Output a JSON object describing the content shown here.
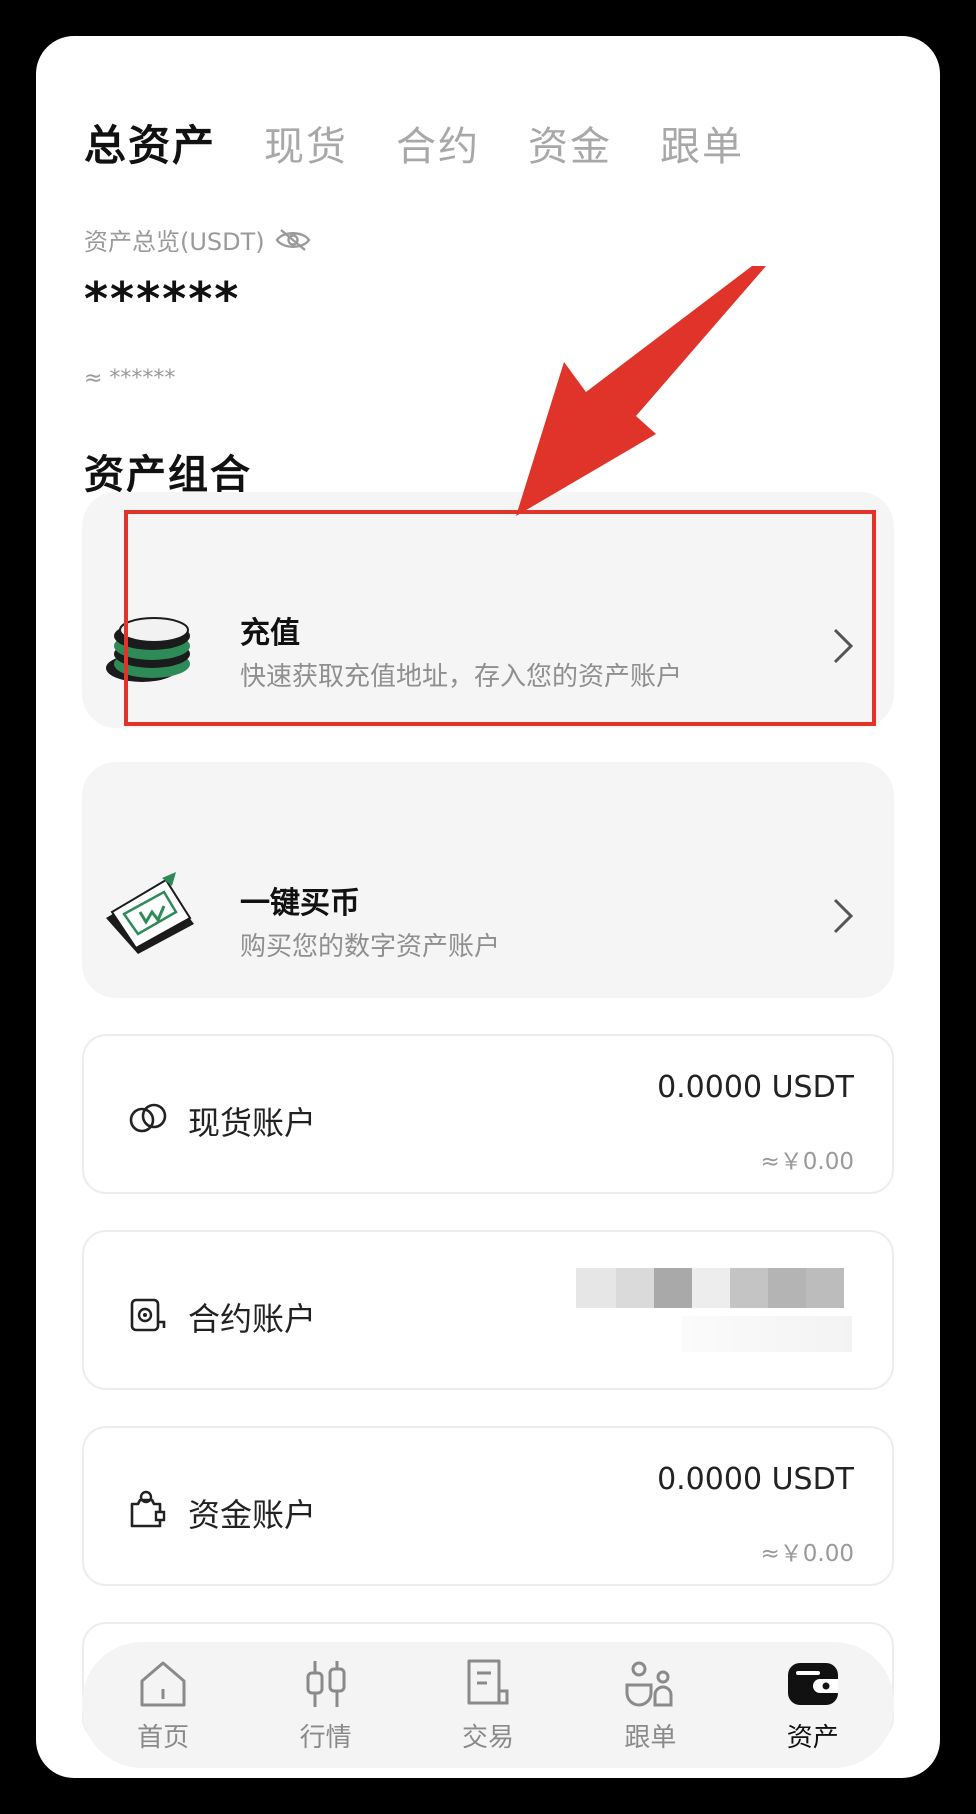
{
  "tabs": [
    {
      "label": "总资产",
      "active": true
    },
    {
      "label": "现货",
      "active": false
    },
    {
      "label": "合约",
      "active": false
    },
    {
      "label": "资金",
      "active": false
    },
    {
      "label": "跟单",
      "active": false
    }
  ],
  "overview": {
    "label": "资产总览(USDT)",
    "total": "******",
    "approx": "≈ ******"
  },
  "section_title": "资产组合",
  "actions": {
    "deposit": {
      "title": "充值",
      "subtitle": "快速获取充值地址，存入您的资产账户"
    },
    "buy": {
      "title": "一键买币",
      "subtitle": "购买您的数字资产账户"
    }
  },
  "accounts": {
    "spot": {
      "name": "现货账户",
      "amount": "0.0000 USDT",
      "cny": "≈￥0.00"
    },
    "contract": {
      "name": "合约账户"
    },
    "fund": {
      "name": "资金账户",
      "amount": "0.0000 USDT",
      "cny": "≈￥0.00"
    }
  },
  "bottom_nav": [
    {
      "label": "首页",
      "icon": "home-icon",
      "active": false
    },
    {
      "label": "行情",
      "icon": "candlestick-icon",
      "active": false
    },
    {
      "label": "交易",
      "icon": "trade-document-icon",
      "active": false
    },
    {
      "label": "跟单",
      "icon": "copy-trade-icon",
      "active": false
    },
    {
      "label": "资产",
      "icon": "wallet-icon",
      "active": true
    }
  ],
  "colors": {
    "accent_green": "#2e8b57",
    "annotation_red": "#e0342a",
    "text_primary": "#111111",
    "text_secondary": "#9a9a9a"
  }
}
